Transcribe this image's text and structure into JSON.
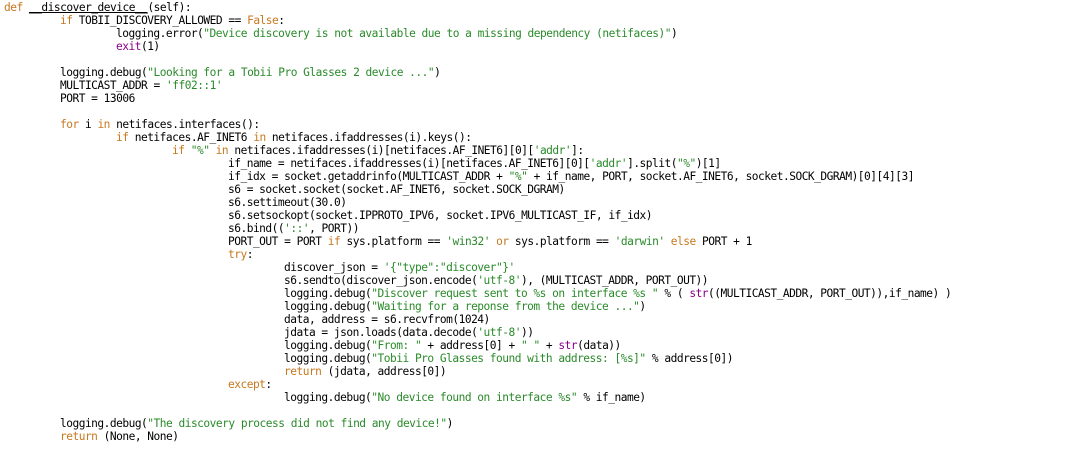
{
  "colors": {
    "keyword": "#c8781e",
    "builtin": "#8b008b",
    "string": "#2a8a2a",
    "text": "#000000",
    "background": "#ffffff"
  },
  "lines": [
    {
      "indent": 0,
      "tokens": [
        {
          "t": "def ",
          "c": "kw"
        },
        {
          "t": "__discover_device__",
          "c": "text",
          "underline": true
        },
        {
          "t": "(self):",
          "c": "text"
        }
      ]
    },
    {
      "indent": 1,
      "tokens": [
        {
          "t": "if ",
          "c": "kw"
        },
        {
          "t": "TOBII_DISCOVERY_ALLOWED == ",
          "c": "text"
        },
        {
          "t": "False",
          "c": "kw"
        },
        {
          "t": ":",
          "c": "text"
        }
      ]
    },
    {
      "indent": 2,
      "tokens": [
        {
          "t": "logging.error(",
          "c": "text"
        },
        {
          "t": "\"Device discovery is not available due to a missing dependency (netifaces)\"",
          "c": "str"
        },
        {
          "t": ")",
          "c": "text"
        }
      ]
    },
    {
      "indent": 2,
      "tokens": [
        {
          "t": "exit",
          "c": "bi"
        },
        {
          "t": "(1)",
          "c": "text"
        }
      ]
    },
    {
      "indent": 0,
      "tokens": []
    },
    {
      "indent": 1,
      "tokens": [
        {
          "t": "logging.debug(",
          "c": "text"
        },
        {
          "t": "\"Looking for a Tobii Pro Glasses 2 device ...\"",
          "c": "str"
        },
        {
          "t": ")",
          "c": "text"
        }
      ]
    },
    {
      "indent": 1,
      "tokens": [
        {
          "t": "MULTICAST_ADDR = ",
          "c": "text"
        },
        {
          "t": "'ff02::1'",
          "c": "str"
        }
      ]
    },
    {
      "indent": 1,
      "tokens": [
        {
          "t": "PORT = 13006",
          "c": "text"
        }
      ]
    },
    {
      "indent": 0,
      "tokens": []
    },
    {
      "indent": 1,
      "tokens": [
        {
          "t": "for ",
          "c": "kw"
        },
        {
          "t": "i ",
          "c": "text"
        },
        {
          "t": "in ",
          "c": "kw"
        },
        {
          "t": "netifaces.interfaces():",
          "c": "text"
        }
      ]
    },
    {
      "indent": 2,
      "tokens": [
        {
          "t": "if ",
          "c": "kw"
        },
        {
          "t": "netifaces.AF_INET6 ",
          "c": "text"
        },
        {
          "t": "in ",
          "c": "kw"
        },
        {
          "t": "netifaces.ifaddresses(i).keys():",
          "c": "text"
        }
      ]
    },
    {
      "indent": 3,
      "tokens": [
        {
          "t": "if ",
          "c": "kw"
        },
        {
          "t": "\"%\"",
          "c": "str"
        },
        {
          "t": " in ",
          "c": "kw"
        },
        {
          "t": "netifaces.ifaddresses(i)[netifaces.AF_INET6][0][",
          "c": "text"
        },
        {
          "t": "'addr'",
          "c": "str"
        },
        {
          "t": "]:",
          "c": "text"
        }
      ]
    },
    {
      "indent": 4,
      "tokens": [
        {
          "t": "if_name = netifaces.ifaddresses(i)[netifaces.AF_INET6][0][",
          "c": "text"
        },
        {
          "t": "'addr'",
          "c": "str"
        },
        {
          "t": "].split(",
          "c": "text"
        },
        {
          "t": "\"%\"",
          "c": "str"
        },
        {
          "t": ")[1]",
          "c": "text"
        }
      ]
    },
    {
      "indent": 4,
      "tokens": [
        {
          "t": "if_idx = socket.getaddrinfo(MULTICAST_ADDR + ",
          "c": "text"
        },
        {
          "t": "\"%\"",
          "c": "str"
        },
        {
          "t": " + if_name, PORT, socket.AF_INET6, socket.SOCK_DGRAM)[0][4][3]",
          "c": "text"
        }
      ]
    },
    {
      "indent": 4,
      "tokens": [
        {
          "t": "s6 = socket.socket(socket.AF_INET6, socket.SOCK_DGRAM)",
          "c": "text"
        }
      ]
    },
    {
      "indent": 4,
      "tokens": [
        {
          "t": "s6.settimeout(30.0)",
          "c": "text"
        }
      ]
    },
    {
      "indent": 4,
      "tokens": [
        {
          "t": "s6.setsockopt(socket.IPPROTO_IPV6, socket.IPV6_MULTICAST_IF, if_idx)",
          "c": "text"
        }
      ]
    },
    {
      "indent": 4,
      "tokens": [
        {
          "t": "s6.bind((",
          "c": "text"
        },
        {
          "t": "'::'",
          "c": "str"
        },
        {
          "t": ", PORT))",
          "c": "text"
        }
      ]
    },
    {
      "indent": 4,
      "tokens": [
        {
          "t": "PORT_OUT = PORT ",
          "c": "text"
        },
        {
          "t": "if ",
          "c": "kw"
        },
        {
          "t": "sys.platform == ",
          "c": "text"
        },
        {
          "t": "'win32'",
          "c": "str"
        },
        {
          "t": " or ",
          "c": "kw"
        },
        {
          "t": "sys.platform == ",
          "c": "text"
        },
        {
          "t": "'darwin'",
          "c": "str"
        },
        {
          "t": " else ",
          "c": "kw"
        },
        {
          "t": "PORT + 1",
          "c": "text"
        }
      ]
    },
    {
      "indent": 4,
      "tokens": [
        {
          "t": "try",
          "c": "kw"
        },
        {
          "t": ":",
          "c": "text"
        }
      ]
    },
    {
      "indent": 5,
      "tokens": [
        {
          "t": "discover_json = ",
          "c": "text"
        },
        {
          "t": "'{\"type\":\"discover\"}'",
          "c": "str"
        }
      ]
    },
    {
      "indent": 5,
      "tokens": [
        {
          "t": "s6.sendto(discover_json.encode(",
          "c": "text"
        },
        {
          "t": "'utf-8'",
          "c": "str"
        },
        {
          "t": "), (MULTICAST_ADDR, PORT_OUT))",
          "c": "text"
        }
      ]
    },
    {
      "indent": 5,
      "tokens": [
        {
          "t": "logging.debug(",
          "c": "text"
        },
        {
          "t": "\"Discover request sent to %s on interface %s \"",
          "c": "str"
        },
        {
          "t": " % ( ",
          "c": "text"
        },
        {
          "t": "str",
          "c": "bi"
        },
        {
          "t": "((MULTICAST_ADDR, PORT_OUT)),if_name) )",
          "c": "text"
        }
      ]
    },
    {
      "indent": 5,
      "tokens": [
        {
          "t": "logging.debug(",
          "c": "text"
        },
        {
          "t": "\"Waiting for a reponse from the device ...\"",
          "c": "str"
        },
        {
          "t": ")",
          "c": "text"
        }
      ]
    },
    {
      "indent": 5,
      "tokens": [
        {
          "t": "data, address = s6.recvfrom(1024)",
          "c": "text"
        }
      ]
    },
    {
      "indent": 5,
      "tokens": [
        {
          "t": "jdata = json.loads(data.decode(",
          "c": "text"
        },
        {
          "t": "'utf-8'",
          "c": "str"
        },
        {
          "t": "))",
          "c": "text"
        }
      ]
    },
    {
      "indent": 5,
      "tokens": [
        {
          "t": "logging.debug(",
          "c": "text"
        },
        {
          "t": "\"From: \"",
          "c": "str"
        },
        {
          "t": " + address[0] + ",
          "c": "text"
        },
        {
          "t": "\" \"",
          "c": "str"
        },
        {
          "t": " + ",
          "c": "text"
        },
        {
          "t": "str",
          "c": "bi"
        },
        {
          "t": "(data))",
          "c": "text"
        }
      ]
    },
    {
      "indent": 5,
      "tokens": [
        {
          "t": "logging.debug(",
          "c": "text"
        },
        {
          "t": "\"Tobii Pro Glasses found with address: [%s]\"",
          "c": "str"
        },
        {
          "t": " % address[0])",
          "c": "text"
        }
      ]
    },
    {
      "indent": 5,
      "tokens": [
        {
          "t": "return ",
          "c": "kw"
        },
        {
          "t": "(jdata, address[0])",
          "c": "text"
        }
      ]
    },
    {
      "indent": 4,
      "tokens": [
        {
          "t": "except",
          "c": "kw"
        },
        {
          "t": ":",
          "c": "text"
        }
      ]
    },
    {
      "indent": 5,
      "tokens": [
        {
          "t": "logging.debug(",
          "c": "text"
        },
        {
          "t": "\"No device found on interface %s\"",
          "c": "str"
        },
        {
          "t": " % if_name)",
          "c": "text"
        }
      ]
    },
    {
      "indent": 0,
      "tokens": []
    },
    {
      "indent": 1,
      "tokens": [
        {
          "t": "logging.debug(",
          "c": "text"
        },
        {
          "t": "\"The discovery process did not find any device!\"",
          "c": "str"
        },
        {
          "t": ")",
          "c": "text"
        }
      ]
    },
    {
      "indent": 1,
      "tokens": [
        {
          "t": "return ",
          "c": "kw"
        },
        {
          "t": "(None, None)",
          "c": "text"
        }
      ]
    }
  ]
}
